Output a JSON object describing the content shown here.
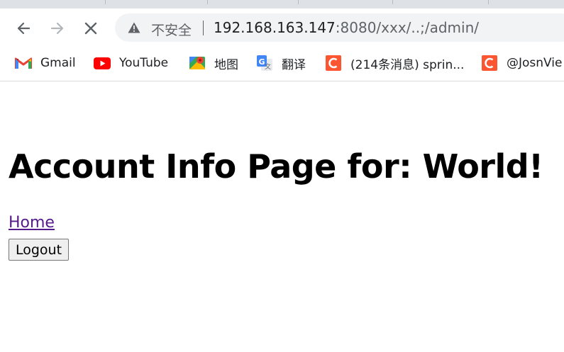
{
  "browser": {
    "security_label": "不安全",
    "url_host": "192.168.163.147",
    "url_rest": ":8080/xxx/..;/admin/"
  },
  "bookmarks": [
    {
      "label": "Gmail",
      "icon": "gmail-icon"
    },
    {
      "label": "YouTube",
      "icon": "youtube-icon"
    },
    {
      "label": "地图",
      "icon": "maps-icon"
    },
    {
      "label": "翻译",
      "icon": "translate-icon"
    },
    {
      "label": "(214条消息) sprin...",
      "icon": "csdn-icon"
    },
    {
      "label": "@JosnVie",
      "icon": "csdn-icon"
    }
  ],
  "page": {
    "heading": "Account Info Page for: World!",
    "home_link": "Home",
    "logout_button": "Logout"
  },
  "colors": {
    "link_visited": "#551a8b",
    "youtube_red": "#ff0000",
    "csdn_orange": "#fc5531"
  }
}
